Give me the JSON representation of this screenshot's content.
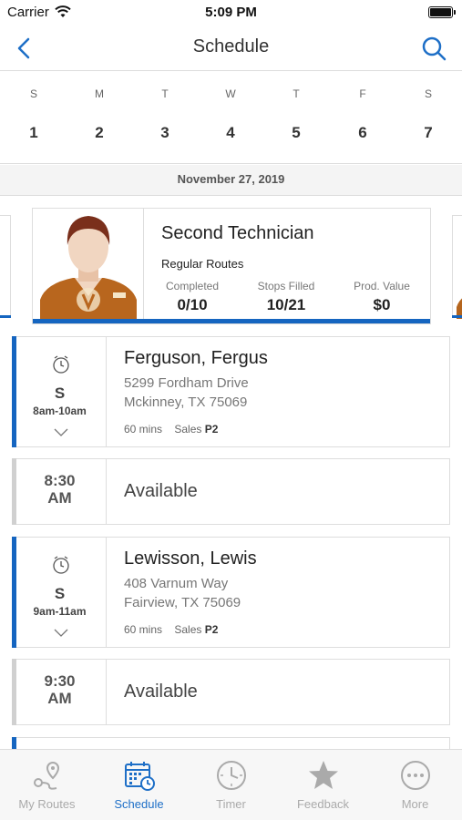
{
  "status_bar": {
    "carrier": "Carrier",
    "time": "5:09 PM"
  },
  "nav": {
    "title": "Schedule",
    "back_icon": "chevron-left-icon",
    "search_icon": "search-icon"
  },
  "week": {
    "days": [
      {
        "letter": "S",
        "number": "1"
      },
      {
        "letter": "M",
        "number": "2"
      },
      {
        "letter": "T",
        "number": "3"
      },
      {
        "letter": "W",
        "number": "4"
      },
      {
        "letter": "T",
        "number": "5"
      },
      {
        "letter": "F",
        "number": "6"
      },
      {
        "letter": "S",
        "number": "7"
      }
    ]
  },
  "date_header": "November 27, 2019",
  "technician": {
    "name": "Second Technician",
    "routes": "Regular Routes",
    "stats": [
      {
        "label": "Completed",
        "value": "0/10"
      },
      {
        "label": "Stops Filled",
        "value": "10/21"
      },
      {
        "label": "Prod. Value",
        "value": "$0"
      }
    ]
  },
  "appointments": [
    {
      "type": "visit",
      "letter": "S",
      "window": "8am-10am",
      "name": "Ferguson, Fergus",
      "address1": "5299 Fordham Drive",
      "address2": "Mckinney, TX 75069",
      "duration": "60 mins",
      "category": "Sales",
      "priority": "P2"
    },
    {
      "type": "slot",
      "time_line1": "8:30",
      "time_line2": "AM",
      "label": "Available"
    },
    {
      "type": "visit",
      "letter": "S",
      "window": "9am-11am",
      "name": "Lewisson, Lewis",
      "address1": "408 Varnum Way",
      "address2": "Fairview, TX 75069",
      "duration": "60 mins",
      "category": "Sales",
      "priority": "P2"
    },
    {
      "type": "slot",
      "time_line1": "9:30",
      "time_line2": "AM",
      "label": "Available"
    }
  ],
  "tabs": [
    {
      "label": "My Routes",
      "icon": "route-map-icon",
      "active": false
    },
    {
      "label": "Schedule",
      "icon": "calendar-clock-icon",
      "active": true
    },
    {
      "label": "Timer",
      "icon": "stopwatch-icon",
      "active": false
    },
    {
      "label": "Feedback",
      "icon": "star-icon",
      "active": false
    },
    {
      "label": "More",
      "icon": "more-dots-icon",
      "active": false
    }
  ],
  "colors": {
    "accent": "#1565c0",
    "tab_active": "#1e6fc7",
    "tab_inactive": "#aaaaaa",
    "slot_accent": "#d0d0d0"
  }
}
